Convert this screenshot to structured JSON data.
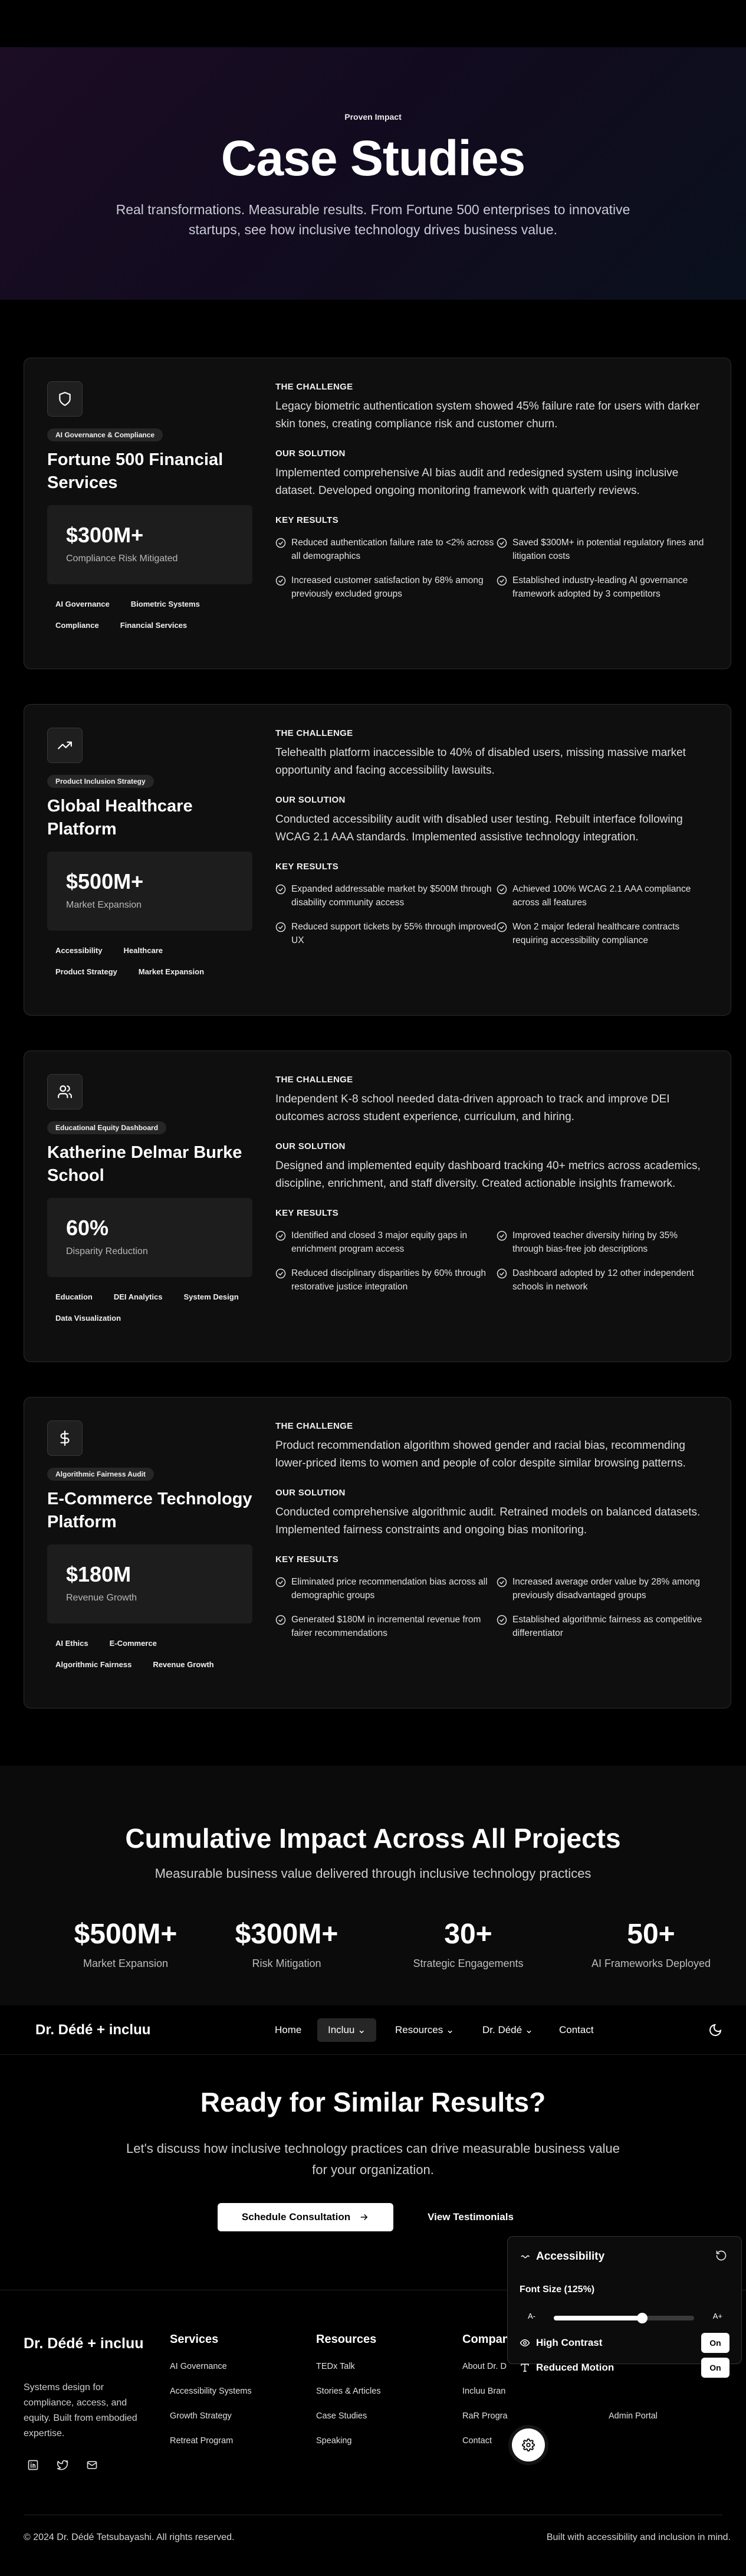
{
  "hero": {
    "eyebrow": "Proven Impact",
    "title": "Case Studies",
    "subtitle": "Real transformations. Measurable results. From Fortune 500 enterprises to innovative startups, see how inclusive technology drives business value."
  },
  "case_labels": {
    "challenge": "THE CHALLENGE",
    "solution": "OUR SOLUTION",
    "results": "KEY RESULTS"
  },
  "cases": [
    {
      "icon": "shield-icon",
      "tag": "AI Governance & Compliance",
      "title": "Fortune 500 Financial Services",
      "metric_value": "$300M+",
      "metric_label": "Compliance Risk Mitigated",
      "badges": [
        "AI Governance",
        "Biometric Systems",
        "Compliance",
        "Financial Services"
      ],
      "challenge": "Legacy biometric authentication system showed 45% failure rate for users with darker skin tones, creating compliance risk and customer churn.",
      "solution": "Implemented comprehensive AI bias audit and redesigned system using inclusive dataset. Developed ongoing monitoring framework with quarterly reviews.",
      "results": [
        "Reduced authentication failure rate to <2% across all demographics",
        "Saved $300M+ in potential regulatory fines and litigation costs",
        "Increased customer satisfaction by 68% among previously excluded groups",
        "Established industry-leading AI governance framework adopted by 3 competitors"
      ]
    },
    {
      "icon": "trending-up-icon",
      "tag": "Product Inclusion Strategy",
      "title": "Global Healthcare Platform",
      "metric_value": "$500M+",
      "metric_label": "Market Expansion",
      "badges": [
        "Accessibility",
        "Healthcare",
        "Product Strategy",
        "Market Expansion"
      ],
      "challenge": "Telehealth platform inaccessible to 40% of disabled users, missing massive market opportunity and facing accessibility lawsuits.",
      "solution": "Conducted accessibility audit with disabled user testing. Rebuilt interface following WCAG 2.1 AAA standards. Implemented assistive technology integration.",
      "results": [
        "Expanded addressable market by $500M through disability community access",
        "Achieved 100% WCAG 2.1 AAA compliance across all features",
        "Reduced support tickets by 55% through improved UX",
        "Won 2 major federal healthcare contracts requiring accessibility compliance"
      ]
    },
    {
      "icon": "users-icon",
      "tag": "Educational Equity Dashboard",
      "title": "Katherine Delmar Burke School",
      "metric_value": "60%",
      "metric_label": "Disparity Reduction",
      "badges": [
        "Education",
        "DEI Analytics",
        "System Design",
        "Data Visualization"
      ],
      "challenge": "Independent K-8 school needed data-driven approach to track and improve DEI outcomes across student experience, curriculum, and hiring.",
      "solution": "Designed and implemented equity dashboard tracking 40+ metrics across academics, discipline, enrichment, and staff diversity. Created actionable insights framework.",
      "results": [
        "Identified and closed 3 major equity gaps in enrichment program access",
        "Improved teacher diversity hiring by 35% through bias-free job descriptions",
        "Reduced disciplinary disparities by 60% through restorative justice integration",
        "Dashboard adopted by 12 other independent schools in network"
      ]
    },
    {
      "icon": "dollar-icon",
      "tag": "Algorithmic Fairness Audit",
      "title": "E-Commerce Technology Platform",
      "metric_value": "$180M",
      "metric_label": "Revenue Growth",
      "badges": [
        "AI Ethics",
        "E-Commerce",
        "Algorithmic Fairness",
        "Revenue Growth"
      ],
      "challenge": "Product recommendation algorithm showed gender and racial bias, recommending lower-priced items to women and people of color despite similar browsing patterns.",
      "solution": "Conducted comprehensive algorithmic audit. Retrained models on balanced datasets. Implemented fairness constraints and ongoing bias monitoring.",
      "results": [
        "Eliminated price recommendation bias across all demographic groups",
        "Increased average order value by 28% among previously disadvantaged groups",
        "Generated $180M in incremental revenue from fairer recommendations",
        "Established algorithmic fairness as competitive differentiator"
      ]
    }
  ],
  "impact": {
    "title": "Cumulative Impact Across All Projects",
    "subtitle": "Measurable business value delivered through inclusive technology practices",
    "stats": [
      {
        "value": "$500M+",
        "label": "Market Expansion"
      },
      {
        "value": "$300M+",
        "label": "Risk Mitigation"
      },
      {
        "value": "30+",
        "label": "Strategic Engagements"
      },
      {
        "value": "50+",
        "label": "AI Frameworks Deployed"
      }
    ]
  },
  "nav": {
    "brand": "Dr. Dédé + incluu",
    "items": [
      "Home",
      "Incluu",
      "Resources",
      "Dr. Dédé",
      "Contact"
    ],
    "active": "Incluu"
  },
  "cta": {
    "title": "Ready for Similar Results?",
    "subtitle": "Let's discuss how inclusive technology practices can drive measurable business value for your organization.",
    "primary": "Schedule Consultation",
    "secondary": "View Testimonials"
  },
  "footer": {
    "brand": "Dr. Dédé + incluu",
    "description": "Systems design for compliance, access, and equity. Built from embodied expertise.",
    "columns": [
      {
        "heading": "Services",
        "links": [
          "AI Governance",
          "Accessibility Systems",
          "Growth Strategy",
          "Retreat Program"
        ]
      },
      {
        "heading": "Resources",
        "links": [
          "TEDx Talk",
          "Stories & Articles",
          "Case Studies",
          "Speaking"
        ]
      },
      {
        "heading": "Compan",
        "links": [
          "About Dr. D",
          "Incluu Bran",
          "RaR Progra",
          "Contact"
        ]
      },
      {
        "heading": "",
        "links": [
          "",
          "",
          "Admin Portal",
          ""
        ]
      }
    ],
    "copyright": "© 2024 Dr. Dédé Tetsubayashi. All rights reserved.",
    "built": "Built with accessibility and inclusion in mind."
  },
  "a11y": {
    "title": "Accessibility",
    "font_label": "Font Size (125%)",
    "a_minus": "A-",
    "a_plus": "A+",
    "font_level": 0.63,
    "high_contrast": "High Contrast",
    "high_contrast_state": "On",
    "reduced_motion": "Reduced Motion",
    "reduced_motion_state": "On"
  }
}
